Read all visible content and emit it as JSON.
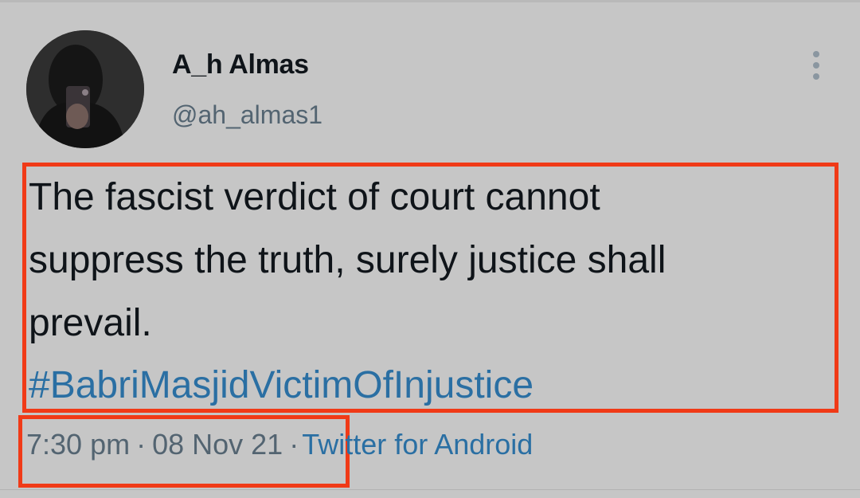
{
  "user": {
    "display_name": "A_h Almas",
    "handle": "@ah_almas1",
    "avatar_icon": "profile-photo"
  },
  "tweet": {
    "text": "The fascist verdict of court cannot\nsuppress the truth, surely justice shall\nprevail.",
    "hashtag": "#BabriMasjidVictimOfInjustice"
  },
  "meta": {
    "time": "7:30 pm",
    "separator": "·",
    "date": "08 Nov 21",
    "source": "Twitter for Android"
  },
  "icons": {
    "more": "more-vertical-icon"
  },
  "colors": {
    "background": "#c6c6c6",
    "highlight": "#f03a17",
    "link": "#2a6fa3",
    "text": "#0f1419",
    "muted": "#536471"
  }
}
